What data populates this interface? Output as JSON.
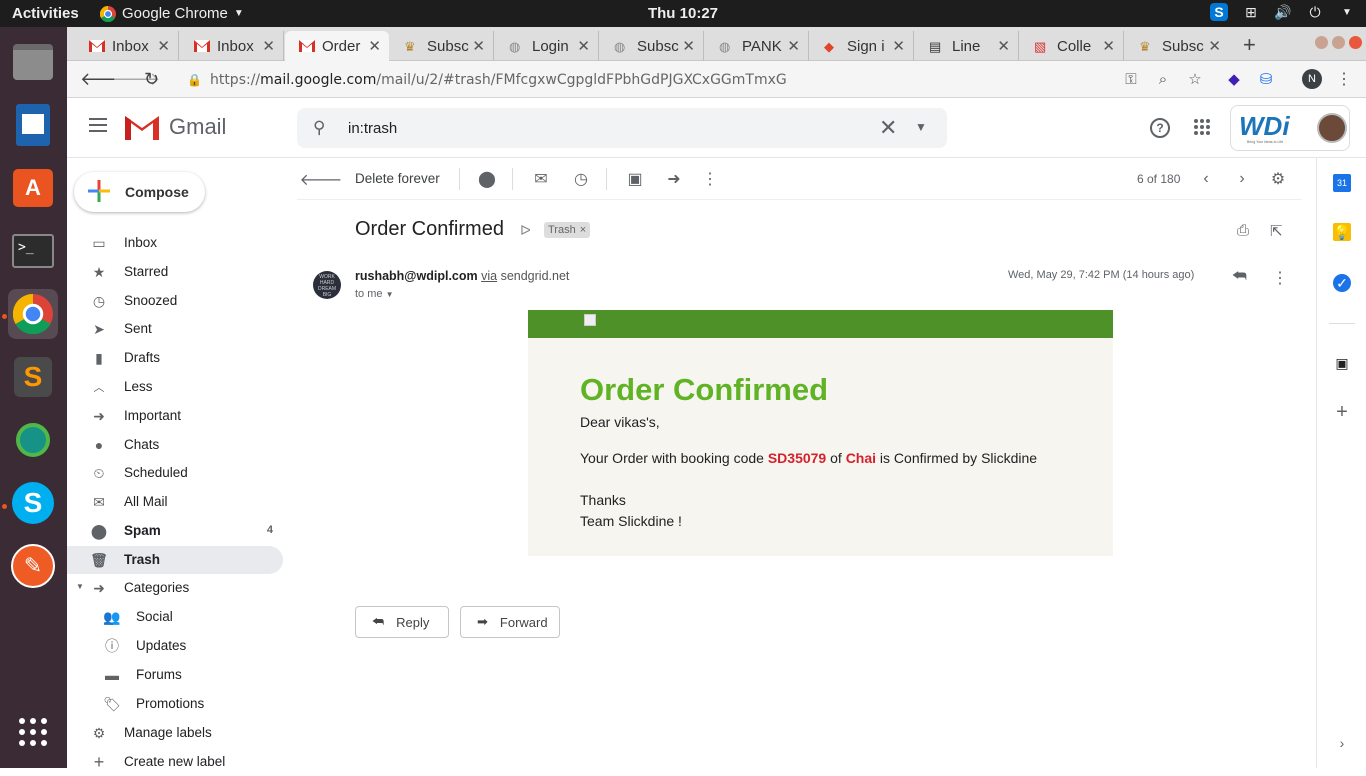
{
  "system": {
    "activities": "Activities",
    "app_name": "Google Chrome",
    "clock": "Thu 10:27"
  },
  "tabs": [
    {
      "title": "Inbox",
      "icon": "gmail-icon"
    },
    {
      "title": "Inbox",
      "icon": "gmail-icon"
    },
    {
      "title": "Order",
      "icon": "gmail-icon",
      "active": true
    },
    {
      "title": "Subsc",
      "icon": "crown-icon"
    },
    {
      "title": "Login",
      "icon": "globe-icon"
    },
    {
      "title": "Subsc",
      "icon": "globe-icon"
    },
    {
      "title": "PANK",
      "icon": "globe-icon"
    },
    {
      "title": "Sign i",
      "icon": "gitlab-icon"
    },
    {
      "title": "Line",
      "icon": "book-icon"
    },
    {
      "title": "Colle",
      "icon": "collection-icon"
    },
    {
      "title": "Subsc",
      "icon": "crown-icon"
    }
  ],
  "browser": {
    "url_prefix": "https://",
    "url_host": "mail.google.com",
    "url_path": "/mail/u/2/#trash/FMfcgxwCgpgldFPbhGdPJGXCxGGmTmxG",
    "profile_initial": "N"
  },
  "gmail": {
    "logo_text": "Gmail",
    "search_value": "in:trash",
    "compose_label": "Compose",
    "brand_text": "WDi",
    "brand_tagline": "Bring Your Ideas to Life"
  },
  "nav": [
    {
      "label": "Inbox",
      "icon": "inbox-icon"
    },
    {
      "label": "Starred",
      "icon": "star-icon"
    },
    {
      "label": "Snoozed",
      "icon": "clock-icon"
    },
    {
      "label": "Sent",
      "icon": "send-icon"
    },
    {
      "label": "Drafts",
      "icon": "draft-icon"
    },
    {
      "label": "Less",
      "icon": "chevron-up-icon"
    },
    {
      "label": "Important",
      "icon": "important-icon"
    },
    {
      "label": "Chats",
      "icon": "chat-icon"
    },
    {
      "label": "Scheduled",
      "icon": "scheduled-icon"
    },
    {
      "label": "All Mail",
      "icon": "mail-icon"
    },
    {
      "label": "Spam",
      "icon": "spam-icon",
      "count": "4"
    },
    {
      "label": "Trash",
      "icon": "trash-icon"
    },
    {
      "label": "Categories",
      "icon": "label-icon"
    },
    {
      "label": "Social",
      "icon": "people-icon"
    },
    {
      "label": "Updates",
      "icon": "info-icon"
    },
    {
      "label": "Forums",
      "icon": "forum-icon"
    },
    {
      "label": "Promotions",
      "icon": "tag-icon"
    },
    {
      "label": "Manage labels",
      "icon": "gear-icon"
    },
    {
      "label": "Create new label",
      "icon": "plus-icon"
    }
  ],
  "toolbar": {
    "delete_forever": "Delete forever",
    "count": "6 of 180"
  },
  "message": {
    "subject": "Order Confirmed",
    "label_chip": "Trash",
    "sender": "rushabh@wdipl.com",
    "via": "via",
    "via_domain": "sendgrid.net",
    "to": "to me",
    "date": "Wed, May 29, 7:42 PM (14 hours ago)",
    "avatar_text": "WORK HARD DREAM BIG"
  },
  "email": {
    "title": "Order Confirmed",
    "greeting": "Dear vikas's,",
    "line_pre": "Your Order with booking code ",
    "booking_code": "SD35079",
    "line_of": " of ",
    "item": "Chai",
    "line_post": " is Confirmed by Slickdine",
    "thanks": "Thanks",
    "team": "Team Slickdine !"
  },
  "actions": {
    "reply": "Reply",
    "forward": "Forward"
  },
  "colors": {
    "email_header_green": "#4f9129",
    "title_green": "#5fb325",
    "highlight_red": "#d3222f",
    "dock_bg": "#3a2b35"
  }
}
